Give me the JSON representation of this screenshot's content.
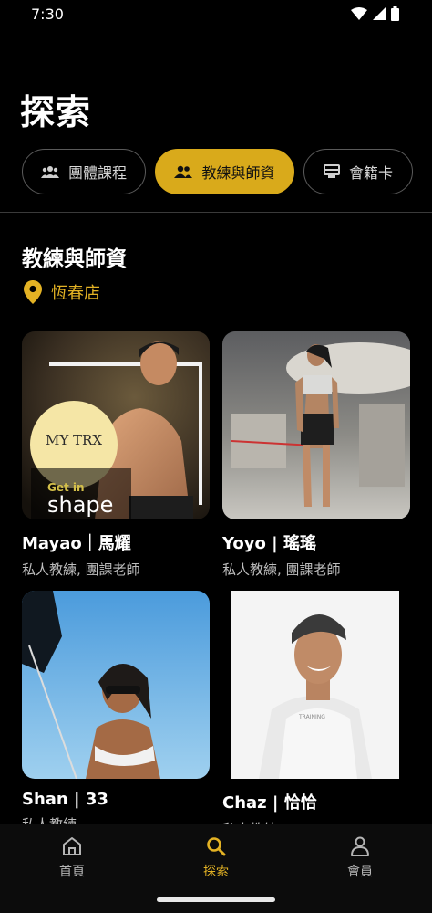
{
  "status": {
    "time": "7:30"
  },
  "page": {
    "title": "探索"
  },
  "tabs": [
    {
      "label": "團體課程",
      "icon": "group-icon",
      "active": false
    },
    {
      "label": "教練與師資",
      "icon": "people-icon",
      "active": true
    },
    {
      "label": "會籍卡",
      "icon": "card-icon",
      "active": false
    }
  ],
  "section": {
    "title": "教練與師資"
  },
  "location": {
    "name": "恆春店",
    "icon": "location-pin-icon"
  },
  "coaches": [
    {
      "name": "Mayao｜馬耀",
      "role": "私人教練, 團課老師",
      "logo_text": "MY TRX",
      "logo_sub": "Get in",
      "logo_shape": "shape"
    },
    {
      "name": "Yoyo | 瑤瑤",
      "role": "私人教練, 團課老師"
    },
    {
      "name": "Shan | 33",
      "role": "私人教練"
    },
    {
      "name": "Chaz | 恰恰",
      "role": "私人教練"
    }
  ],
  "nav": [
    {
      "label": "首頁",
      "icon": "home-icon"
    },
    {
      "label": "探索",
      "icon": "search-icon"
    },
    {
      "label": "會員",
      "icon": "person-icon"
    }
  ],
  "colors": {
    "accent": "#d9aa1b",
    "background": "#000000"
  }
}
